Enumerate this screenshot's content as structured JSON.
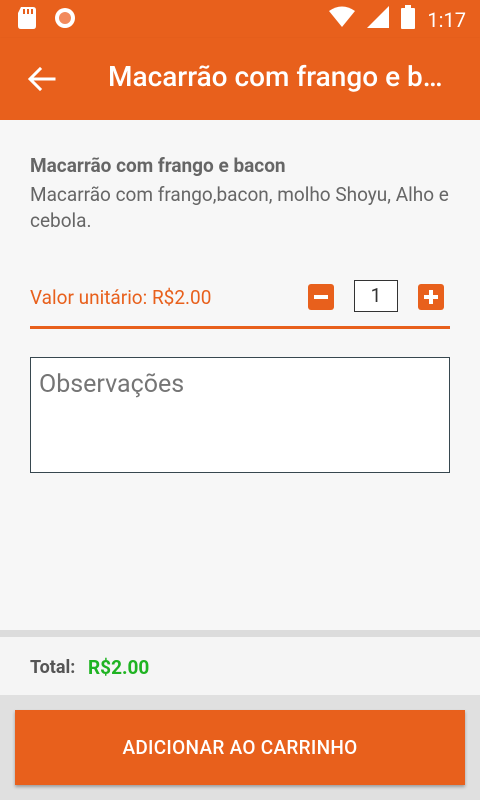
{
  "status_bar": {
    "time": "1:17"
  },
  "app_bar": {
    "title": "Macarrão com frango e bacon",
    "back_icon": "arrow-left-icon"
  },
  "product": {
    "name": "Macarrão com frango e bacon",
    "description": "Macarrão com frango,bacon, molho Shoyu, Alho e cebola."
  },
  "pricing": {
    "unit_price_label": "Valor unitário: R$2.00",
    "quantity": "1"
  },
  "observations": {
    "placeholder": "Observações"
  },
  "totals": {
    "label": "Total:",
    "value": "R$2.00"
  },
  "actions": {
    "add_to_cart": "ADICIONAR AO CARRINHO"
  },
  "colors": {
    "accent": "#e8601c",
    "total_green": "#1fb322"
  }
}
